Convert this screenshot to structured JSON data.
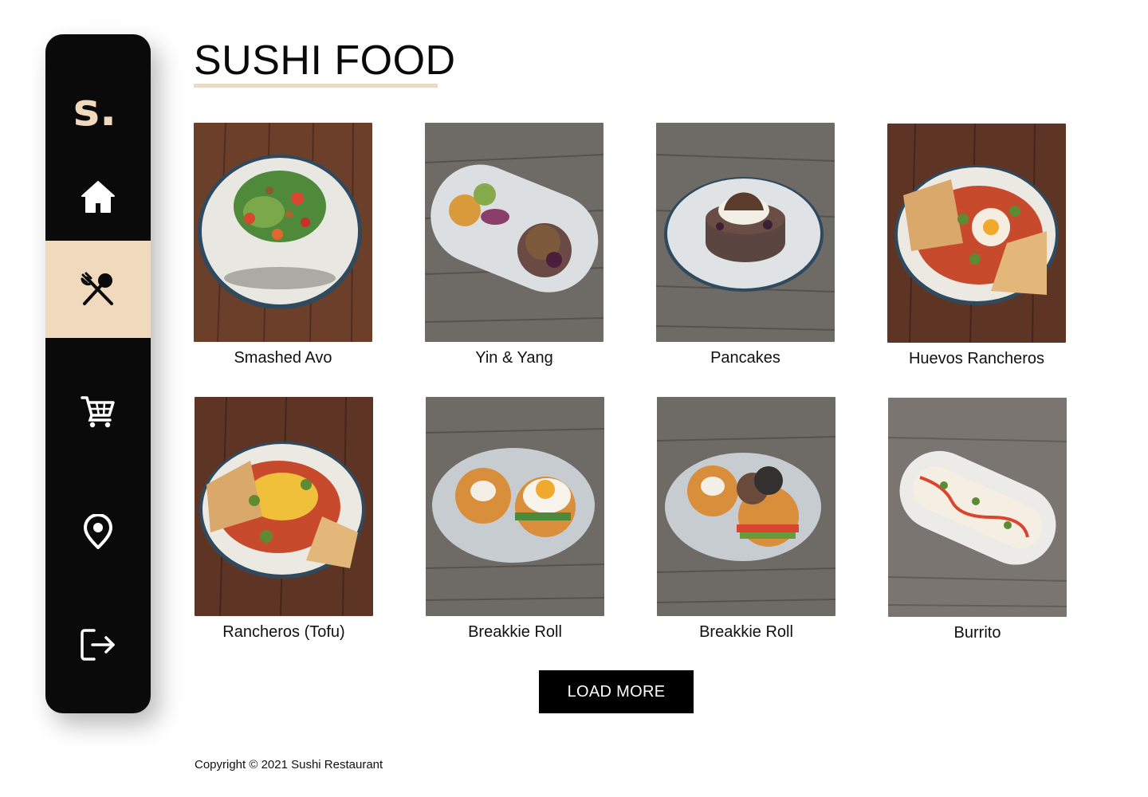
{
  "brand": {
    "logo_text": "s.",
    "accent_color": "#f1d9bd"
  },
  "sidebar": {
    "items": [
      {
        "icon": "home-icon",
        "active": false
      },
      {
        "icon": "fork-spoon-icon",
        "active": true
      },
      {
        "icon": "cart-icon",
        "active": false
      },
      {
        "icon": "location-pin-icon",
        "active": false
      },
      {
        "icon": "logout-icon",
        "active": false
      }
    ]
  },
  "page": {
    "title": "SUSHI FOOD"
  },
  "menu_items": [
    {
      "name": "Smashed Avo",
      "wood": "#6b3f2a"
    },
    {
      "name": "Yin & Yang",
      "wood": "#6e6a66"
    },
    {
      "name": "Pancakes",
      "wood": "#6e6a66"
    },
    {
      "name": "Huevos Rancheros",
      "wood": "#5e3525"
    },
    {
      "name": "Rancheros (Tofu)",
      "wood": "#5e3525"
    },
    {
      "name": "Breakkie Roll",
      "wood": "#6e6a66"
    },
    {
      "name": "Breakkie Roll",
      "wood": "#6e6a66"
    },
    {
      "name": "Burrito",
      "wood": "#7a7570"
    }
  ],
  "actions": {
    "load_more_label": "LOAD MORE"
  },
  "footer": {
    "copyright": "Copyright © 2021 Sushi Restaurant"
  }
}
